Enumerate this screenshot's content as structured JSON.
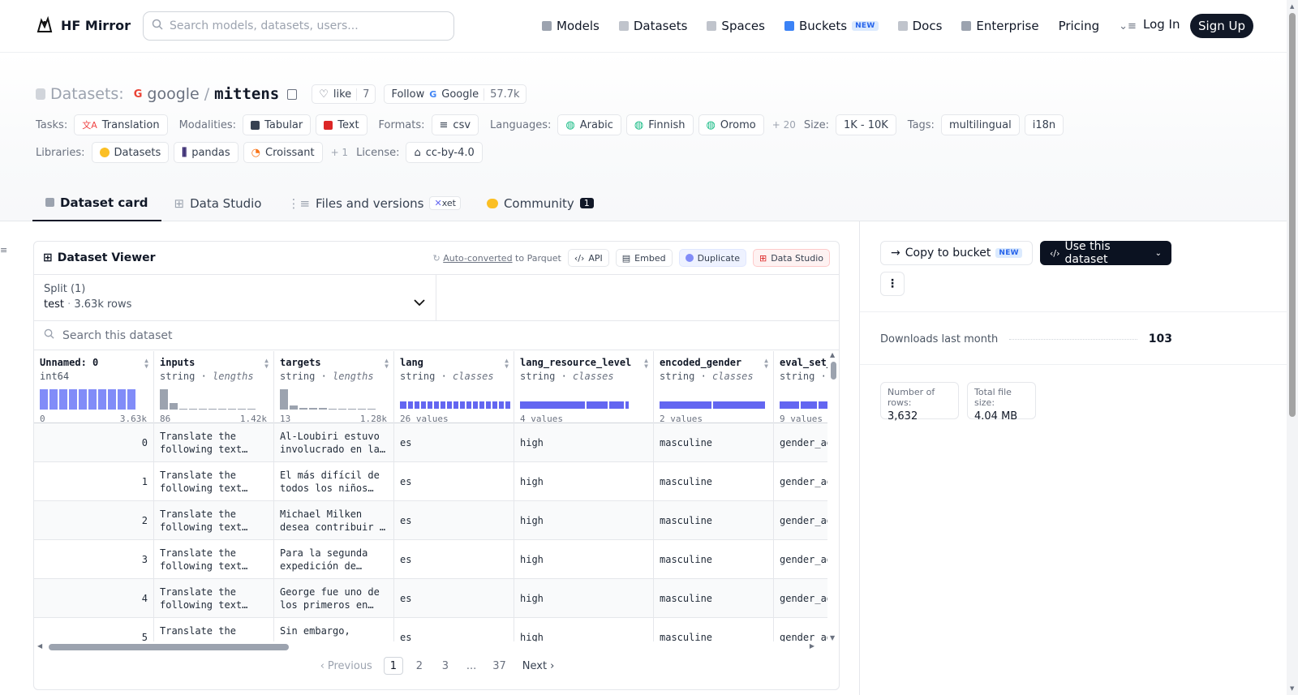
{
  "nav": {
    "brand": "HF Mirror",
    "search_placeholder": "Search models, datasets, users...",
    "links": [
      {
        "label": "Models",
        "icon": "cube-icon",
        "color": "#9ca3af"
      },
      {
        "label": "Datasets",
        "icon": "database-icon",
        "color": "#9ca3af"
      },
      {
        "label": "Spaces",
        "icon": "grid-icon",
        "color": "#9ca3af"
      },
      {
        "label": "Buckets",
        "icon": "bucket-icon",
        "color": "#3b82f6",
        "badge": "NEW"
      },
      {
        "label": "Docs",
        "icon": "book-icon",
        "color": "#9ca3af"
      },
      {
        "label": "Enterprise",
        "icon": "enterprise-icon",
        "color": "#9ca3af"
      },
      {
        "label": "Pricing"
      }
    ],
    "login": "Log In",
    "signup": "Sign Up"
  },
  "repo": {
    "type_label": "Datasets:",
    "owner": "google",
    "separator": "/",
    "name": "mittens",
    "like_label": "like",
    "like_count": "7",
    "follow_label": "Follow",
    "follow_org": "Google",
    "followers": "57.7k"
  },
  "meta": {
    "tasks_label": "Tasks:",
    "tasks": [
      "Translation"
    ],
    "modalities_label": "Modalities:",
    "modalities": [
      "Tabular",
      "Text"
    ],
    "formats_label": "Formats:",
    "formats": [
      "csv"
    ],
    "languages_label": "Languages:",
    "languages": [
      "Arabic",
      "Finnish",
      "Oromo"
    ],
    "languages_more": "+ 20",
    "size_label": "Size:",
    "size": "1K - 10K",
    "tags_label": "Tags:",
    "tags": [
      "multilingual",
      "i18n"
    ],
    "libraries_label": "Libraries:",
    "libraries": [
      "Datasets",
      "pandas",
      "Croissant"
    ],
    "libraries_more": "+ 1",
    "license_label": "License:",
    "license": "cc-by-4.0"
  },
  "tabs": [
    {
      "label": "Dataset card",
      "active": true
    },
    {
      "label": "Data Studio"
    },
    {
      "label": "Files and versions",
      "badge": "xet"
    },
    {
      "label": "Community",
      "count": "1"
    }
  ],
  "viewer": {
    "title": "Dataset Viewer",
    "autoconv_link": "Auto-converted",
    "autoconv_rest": " to Parquet",
    "api": "API",
    "embed": "Embed",
    "duplicate": "Duplicate",
    "studio": "Data Studio",
    "split_label": "Split (1)",
    "split_name": "test",
    "split_rows": "3.63k rows",
    "search_placeholder": "Search this dataset",
    "columns": [
      {
        "name": "Unnamed: 0",
        "type": "int64",
        "kind": "",
        "min": "0",
        "max": "3.63k",
        "hist": [
          1,
          1,
          1,
          1,
          1,
          1,
          1,
          1,
          1,
          1
        ]
      },
      {
        "name": "inputs",
        "type": "string",
        "kind": "lengths",
        "min": "86",
        "max": "1.42k",
        "hist": [
          1,
          0.3,
          0.05,
          0.05,
          0.05,
          0.05,
          0.05,
          0.05,
          0.05,
          0.05
        ]
      },
      {
        "name": "targets",
        "type": "string",
        "kind": "lengths",
        "min": "13",
        "max": "1.28k",
        "hist": [
          1,
          0.2,
          0.06,
          0.08,
          0.06,
          0.05,
          0.05,
          0,
          0.05,
          0.05
        ]
      },
      {
        "name": "lang",
        "type": "string",
        "kind": "classes",
        "values": "26 values"
      },
      {
        "name": "lang_resource_level",
        "type": "string",
        "kind": "classes",
        "values": "4 values"
      },
      {
        "name": "encoded_gender",
        "type": "string",
        "kind": "classes",
        "values": "2 values"
      },
      {
        "name": "eval_set_",
        "type": "string",
        "kind": "c",
        "values": "9 values"
      }
    ],
    "rows": [
      {
        "id": "0",
        "inputs": "Translate the following text…",
        "targets": "Al-Loubiri estuvo involucrado en la…",
        "lang": "es",
        "level": "high",
        "gender": "masculine",
        "eval": "gender_ag"
      },
      {
        "id": "1",
        "inputs": "Translate the following text…",
        "targets": "El más difícil de todos los niños…",
        "lang": "es",
        "level": "high",
        "gender": "masculine",
        "eval": "gender_ag"
      },
      {
        "id": "2",
        "inputs": "Translate the following text…",
        "targets": "Michael Milken desea contribuir …",
        "lang": "es",
        "level": "high",
        "gender": "masculine",
        "eval": "gender_ag"
      },
      {
        "id": "3",
        "inputs": "Translate the following text…",
        "targets": "Para la segunda expedición de…",
        "lang": "es",
        "level": "high",
        "gender": "masculine",
        "eval": "gender_ag"
      },
      {
        "id": "4",
        "inputs": "Translate the following text…",
        "targets": "George fue uno de los primeros en…",
        "lang": "es",
        "level": "high",
        "gender": "masculine",
        "eval": "gender_ag"
      },
      {
        "id": "5",
        "inputs": "Translate the",
        "targets": "Sin embargo,",
        "lang": "es",
        "level": "high",
        "gender": "masculine",
        "eval": "gender_ag"
      }
    ],
    "pager": {
      "prev": "Previous",
      "pages": [
        "1",
        "2",
        "3",
        "...",
        "37"
      ],
      "next": "Next"
    }
  },
  "side": {
    "copy_bucket": "Copy to bucket",
    "copy_badge": "NEW",
    "use_dataset": "Use this dataset",
    "downloads_label": "Downloads last month",
    "downloads": "103",
    "rows_label": "Number of rows:",
    "rows_value": "3,632",
    "size_label": "Total file size:",
    "size_value": "4.04 MB"
  }
}
